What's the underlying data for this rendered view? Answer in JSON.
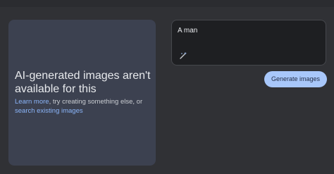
{
  "notice": {
    "title": "AI-generated images aren't available for this",
    "learn_more": "Learn more",
    "middle_text": ", try creating something else, or ",
    "search_link": "search existing images"
  },
  "prompt": {
    "text": "A man",
    "icon": "magic-wand-icon"
  },
  "actions": {
    "generate_label": "Generate images"
  },
  "colors": {
    "background": "#303135",
    "panel": "#3c4150",
    "prompt_box": "#1e1f22",
    "link": "#8ab4f8",
    "button": "#a8c7fa"
  }
}
